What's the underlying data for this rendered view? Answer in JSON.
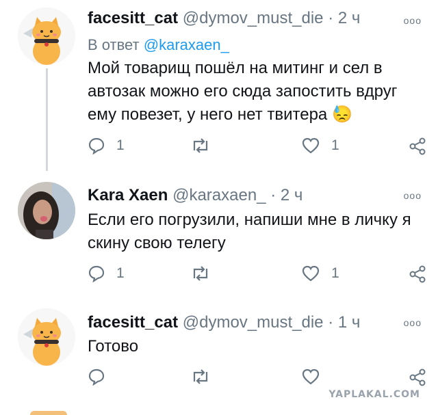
{
  "tweets": [
    {
      "name": "facesitt_cat",
      "handle": "@dymov_must_die",
      "time": "2 ч",
      "reply_prefix": "В ответ",
      "reply_mention": "@karaxaen_",
      "text": "Мой товарищ пошёл на митинг и сел в автозак можно его сюда запостить вдруг ему повезет, у него нет твитера",
      "emoji": "😓",
      "replies": "1",
      "retweets": "",
      "likes": "1",
      "avatar_icon": "cat-avatar-icon"
    },
    {
      "name": "Kara Xaen",
      "handle": "@karaxaen_",
      "time": "2 ч",
      "text": "Если его погрузили, напиши мне в личку я скину свою телегу",
      "replies": "1",
      "retweets": "",
      "likes": "1",
      "avatar_icon": "user-photo-avatar"
    },
    {
      "name": "facesitt_cat",
      "handle": "@dymov_must_die",
      "time": "1 ч",
      "text": "Готово",
      "replies": "",
      "retweets": "",
      "likes": "",
      "avatar_icon": "cat-avatar-icon"
    }
  ],
  "dot": "·",
  "more_glyph": "ooo",
  "watermark": "YAPLAKAL.COM",
  "colors": {
    "accent": "#1d9bf0",
    "secondary_text": "#687682",
    "thread_line": "#d3d8dc"
  }
}
